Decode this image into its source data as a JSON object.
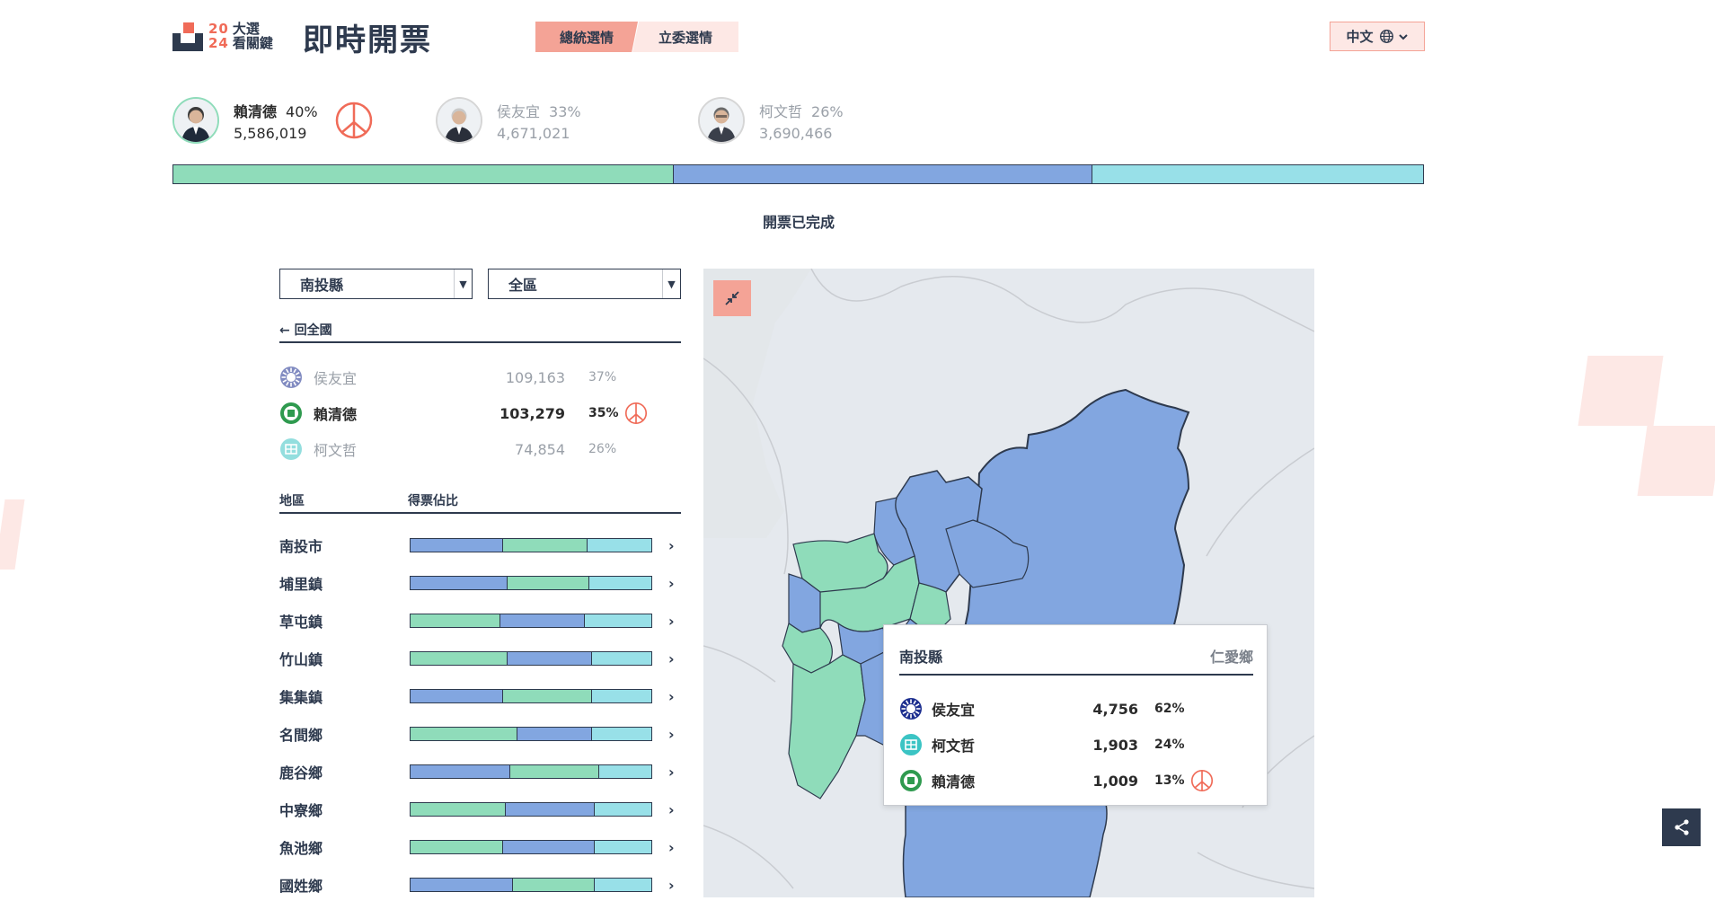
{
  "header": {
    "logo_year_top": "20",
    "logo_year_bottom": "24",
    "logo_text_top": "大選",
    "logo_text_bottom": "看關鍵",
    "title": "即時開票",
    "tabs": [
      {
        "label": "總統選情",
        "active": true
      },
      {
        "label": "立委選情",
        "active": false
      }
    ],
    "language": "中文"
  },
  "summary": {
    "candidates": [
      {
        "name": "賴清德",
        "pct": "40%",
        "votes": "5,586,019",
        "elected": true,
        "color": "#8fdcba"
      },
      {
        "name": "侯友宜",
        "pct": "33%",
        "votes": "4,671,021",
        "elected": false,
        "color": "#82a6e0"
      },
      {
        "name": "柯文哲",
        "pct": "26%",
        "votes": "3,690,466",
        "elected": false,
        "color": "#98e0e8"
      }
    ],
    "bar_shares": [
      0.4,
      0.335,
      0.265
    ],
    "status": "開票已完成"
  },
  "filters": {
    "county": "南投縣",
    "district": "全區",
    "back_label": "回全國"
  },
  "county_results": [
    {
      "name": "侯友宜",
      "votes": "109,163",
      "pct": "37%",
      "party": "kmt",
      "lead": false,
      "elected": false
    },
    {
      "name": "賴清德",
      "votes": "103,279",
      "pct": "35%",
      "party": "dpp",
      "lead": true,
      "elected": true
    },
    {
      "name": "柯文哲",
      "votes": "74,854",
      "pct": "26%",
      "party": "tpp",
      "lead": false,
      "elected": false
    }
  ],
  "table": {
    "col_region": "地區",
    "col_share": "得票佔比",
    "rows": [
      {
        "name": "南投市",
        "order": [
          "kmt",
          "dpp",
          "tpp"
        ],
        "shares": [
          0.38,
          0.35,
          0.27
        ]
      },
      {
        "name": "埔里鎮",
        "order": [
          "kmt",
          "dpp",
          "tpp"
        ],
        "shares": [
          0.4,
          0.34,
          0.26
        ]
      },
      {
        "name": "草屯鎮",
        "order": [
          "dpp",
          "kmt",
          "tpp"
        ],
        "shares": [
          0.37,
          0.35,
          0.28
        ]
      },
      {
        "name": "竹山鎮",
        "order": [
          "dpp",
          "kmt",
          "tpp"
        ],
        "shares": [
          0.4,
          0.35,
          0.25
        ]
      },
      {
        "name": "集集鎮",
        "order": [
          "kmt",
          "dpp",
          "tpp"
        ],
        "shares": [
          0.38,
          0.37,
          0.25
        ]
      },
      {
        "name": "名間鄉",
        "order": [
          "dpp",
          "kmt",
          "tpp"
        ],
        "shares": [
          0.44,
          0.31,
          0.25
        ]
      },
      {
        "name": "鹿谷鄉",
        "order": [
          "kmt",
          "dpp",
          "tpp"
        ],
        "shares": [
          0.41,
          0.37,
          0.22
        ]
      },
      {
        "name": "中寮鄉",
        "order": [
          "dpp",
          "kmt",
          "tpp"
        ],
        "shares": [
          0.39,
          0.37,
          0.24
        ]
      },
      {
        "name": "魚池鄉",
        "order": [
          "dpp",
          "kmt",
          "tpp"
        ],
        "shares": [
          0.38,
          0.38,
          0.24
        ]
      },
      {
        "name": "國姓鄉",
        "order": [
          "kmt",
          "dpp",
          "tpp"
        ],
        "shares": [
          0.42,
          0.34,
          0.24
        ]
      }
    ]
  },
  "tooltip": {
    "county": "南投縣",
    "town": "仁愛鄉",
    "rows": [
      {
        "name": "侯友宜",
        "votes": "4,756",
        "pct": "62%",
        "party": "kmt",
        "elected": false
      },
      {
        "name": "柯文哲",
        "votes": "1,903",
        "pct": "24%",
        "party": "tpp",
        "elected": false
      },
      {
        "name": "賴清德",
        "votes": "1,009",
        "pct": "13%",
        "party": "dpp",
        "elected": true
      }
    ]
  },
  "colors": {
    "dpp": "#8fdcba",
    "kmt": "#82a6e0",
    "tpp": "#98e0e8",
    "accent": "#f4a396",
    "accent_light": "#fde8e5",
    "navy": "#2e3a4e",
    "elected": "#f06b58"
  }
}
